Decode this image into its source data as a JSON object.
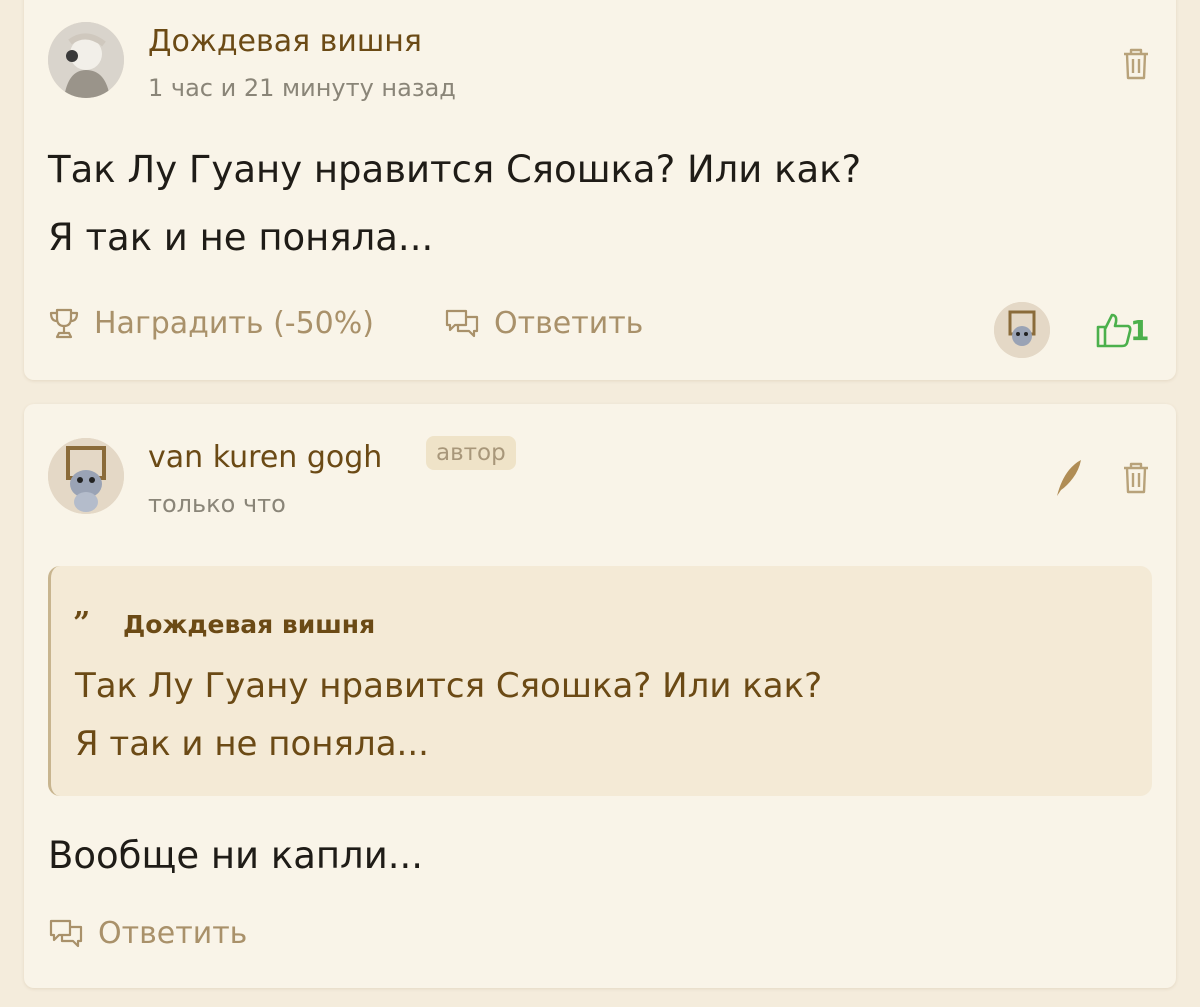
{
  "comments": [
    {
      "author": "Дождевая вишня",
      "time": "1 час и 21 минуту назад",
      "lines": [
        "Так Лу Гуану нравится Сяошка? Или как?",
        "Я так и не поняла..."
      ],
      "reward_label": "Наградить (-50%)",
      "reply_label": "Ответить",
      "likes": "1"
    },
    {
      "author": "van kuren gogh",
      "badge": "автор",
      "time": "только что",
      "quote": {
        "author": "Дождевая вишня",
        "lines": [
          "Так Лу Гуану нравится Сяошка? Или как?",
          "Я так и не поняла..."
        ]
      },
      "lines": [
        "Вообще ни капли..."
      ],
      "reply_label": "Ответить"
    }
  ],
  "colors": {
    "accent": "#6b4a15",
    "muted": "#a9916a",
    "like": "#4cb04c",
    "background": "#f4ecdc",
    "card": "#f9f4e8"
  },
  "icons": [
    "trash-icon",
    "trophy-icon",
    "reply-icon",
    "thumbs-up-icon",
    "feather-edit-icon",
    "quote-icon"
  ]
}
